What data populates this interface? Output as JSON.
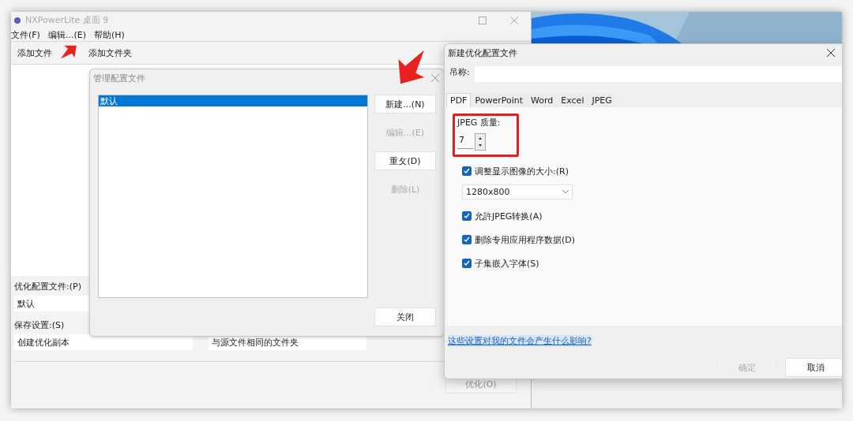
{
  "main_window": {
    "title": "NXPowerLite 桌面 9",
    "menu": [
      {
        "label": "文件(F)"
      },
      {
        "label": "编辑...(E)"
      },
      {
        "label": "帮助(H)"
      }
    ],
    "toolbar": [
      {
        "label": "添加文件"
      },
      {
        "label": "添加文件夹"
      }
    ],
    "profile_label": "优化配置文件:(P)",
    "profile_value": "默认",
    "save_label": "保存设置:(S)",
    "save_value": "创建优化副本",
    "folder_value": "与源文件相同的文件夹",
    "optimize_button": {
      "label": "优化(O)",
      "disabled": true
    }
  },
  "manage_dialog": {
    "title": "管理配置文件",
    "profiles": [
      {
        "label": "默认",
        "selected": true
      }
    ],
    "buttons": [
      {
        "label": "新建...(N)",
        "disabled": false
      },
      {
        "label": "编辑...(E)",
        "disabled": true
      },
      {
        "label": "重攵(D)",
        "disabled": false
      },
      {
        "label": "删除(L)",
        "disabled": true
      }
    ],
    "close_button": "关闭"
  },
  "new_dialog": {
    "title": "新建优化配置文件",
    "name_label": "吊称:",
    "tabs": [
      {
        "label": "PDF",
        "selected": true
      },
      {
        "label": "PowerPoint",
        "selected": false
      },
      {
        "label": "Word",
        "selected": false
      },
      {
        "label": "Excel",
        "selected": false
      },
      {
        "label": "JPEG",
        "selected": false
      }
    ],
    "jpeg_quality_label": "JPEG 质量:",
    "jpeg_quality_value": "7",
    "options": [
      {
        "kind": "checkbox",
        "label": "调整显示图像的大小:(R)",
        "checked": true
      },
      {
        "kind": "select",
        "value": "1280x800"
      },
      {
        "kind": "checkbox",
        "label": "允許JPEG转换(A)",
        "checked": true
      },
      {
        "kind": "checkbox",
        "label": "删除专用应用程序数据(D)",
        "checked": true
      },
      {
        "kind": "checkbox",
        "label": "子集嵌入字体(S)",
        "checked": true
      }
    ],
    "help_link": "这些设置对我的文件会产生什么影响?",
    "buttons": [
      {
        "label": "确定",
        "disabled": true
      },
      {
        "label": "取消",
        "disabled": false
      }
    ]
  }
}
